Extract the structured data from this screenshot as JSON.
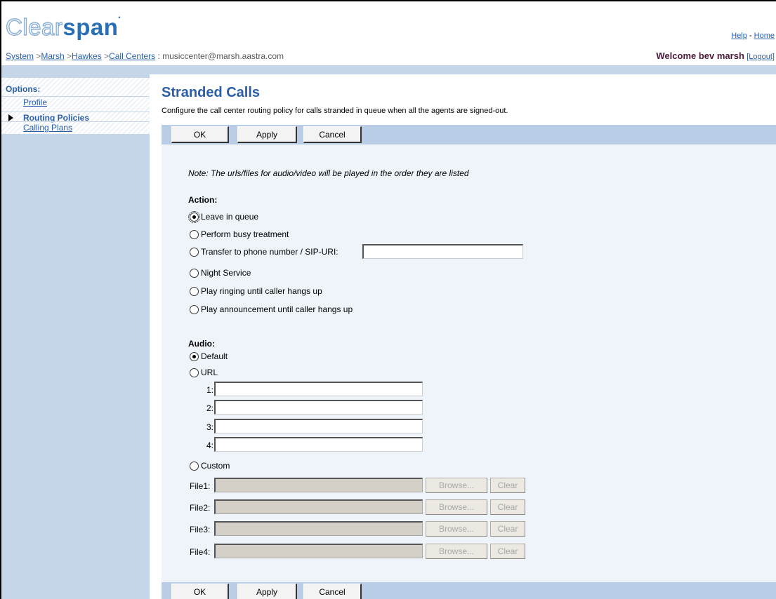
{
  "header": {
    "logo_light": "Clear",
    "logo_bold": "span",
    "logo_mark": "•",
    "help_link": "Help",
    "help_sep": " - ",
    "home_link": "Home",
    "breadcrumb": {
      "system": "System",
      "marsh": "Marsh",
      "hawkes": "Hawkes",
      "call_centers": "Call Centers",
      "sep": " >",
      "current": " : musiccenter@marsh.aastra.com"
    },
    "welcome": "Welcome bev marsh",
    "logout": "[Logout]"
  },
  "sidebar": {
    "options_label": "Options:",
    "items": [
      {
        "label": "Profile",
        "active": false
      },
      {
        "label": "Routing Policies",
        "active": true
      },
      {
        "label": "Calling Plans",
        "active": false
      }
    ]
  },
  "main": {
    "title": "Stranded Calls",
    "description": "Configure the call center routing policy for calls stranded in queue when all the agents are signed-out.",
    "buttons": {
      "ok": "OK",
      "apply": "Apply",
      "cancel": "Cancel"
    },
    "note": "Note: The urls/files for audio/video will be played in the order they are listed",
    "action": {
      "label": "Action:",
      "options": [
        {
          "label": "Leave in queue",
          "checked": true
        },
        {
          "label": "Perform busy treatment",
          "checked": false
        },
        {
          "label": "Transfer to phone number / SIP-URI:",
          "checked": false
        },
        {
          "label": "Night Service",
          "checked": false
        },
        {
          "label": "Play ringing until caller hangs up",
          "checked": false
        },
        {
          "label": "Play announcement until caller hangs up",
          "checked": false
        }
      ],
      "transfer_value": ""
    },
    "audio": {
      "label": "Audio:",
      "default_label": "Default",
      "url_label": "URL",
      "custom_label": "Custom",
      "selected": "Default",
      "url_fields": [
        {
          "label": "1:",
          "value": ""
        },
        {
          "label": "2:",
          "value": ""
        },
        {
          "label": "3:",
          "value": ""
        },
        {
          "label": "4:",
          "value": ""
        }
      ],
      "files": [
        {
          "label": "File1:",
          "browse": "Browse...",
          "clear": "Clear"
        },
        {
          "label": "File2:",
          "browse": "Browse...",
          "clear": "Clear"
        },
        {
          "label": "File3:",
          "browse": "Browse...",
          "clear": "Clear"
        },
        {
          "label": "File4:",
          "browse": "Browse...",
          "clear": "Clear"
        }
      ]
    }
  },
  "colors": {
    "link": "#2a5fa8",
    "title": "#2a5fa8",
    "sidebar_bg": "#c5d6ea",
    "button_bar": "#b9cde6",
    "content_bg": "#eef4fa",
    "welcome": "#4a1a3a"
  }
}
